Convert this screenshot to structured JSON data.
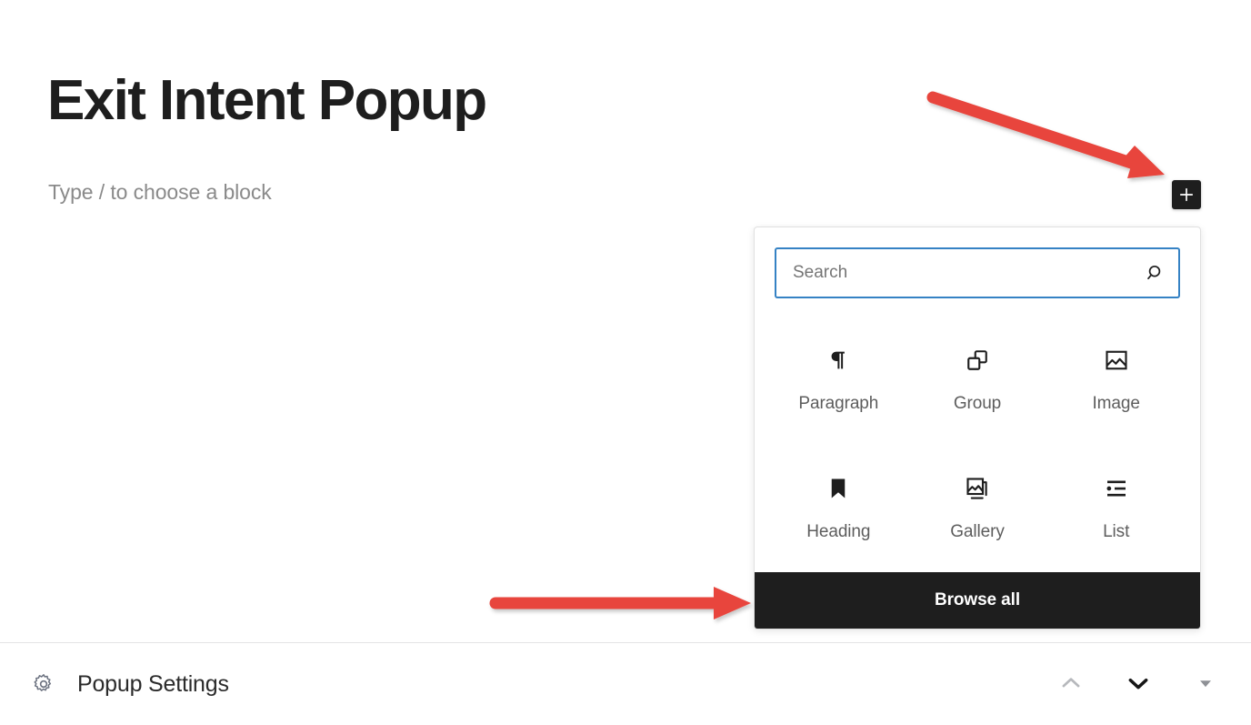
{
  "editor": {
    "post_title": "Exit Intent Popup",
    "block_placeholder": "Type / to choose a block",
    "add_block_button_label": "+"
  },
  "inserter": {
    "search": {
      "value": "",
      "placeholder": "Search",
      "icon": "search-icon",
      "focused": true,
      "focus_color": "#3582c4"
    },
    "blocks": [
      {
        "label": "Paragraph",
        "icon": "paragraph-icon"
      },
      {
        "label": "Group",
        "icon": "group-icon"
      },
      {
        "label": "Image",
        "icon": "image-icon"
      },
      {
        "label": "Heading",
        "icon": "heading-icon"
      },
      {
        "label": "Gallery",
        "icon": "gallery-icon"
      },
      {
        "label": "List",
        "icon": "list-icon"
      }
    ],
    "browse_all_label": "Browse all",
    "browse_all_color": "#1e1e1e"
  },
  "settings_panel": {
    "icon": "gear-icon",
    "title": "Popup Settings",
    "controls": [
      {
        "name": "move-up",
        "icon": "chevron-up-icon",
        "color": "#b6b8bc"
      },
      {
        "name": "move-down",
        "icon": "chevron-down-icon",
        "color": "#171717"
      },
      {
        "name": "toggle-panel",
        "icon": "caret-down-icon",
        "color": "#8e9196"
      }
    ]
  },
  "annotations": {
    "color": "#e8453c",
    "arrows": [
      {
        "name": "arrow-to-add-block",
        "target": "add-block-button",
        "direction": "down-right"
      },
      {
        "name": "arrow-to-browse-all",
        "target": "browse-all-button",
        "direction": "right"
      }
    ]
  }
}
